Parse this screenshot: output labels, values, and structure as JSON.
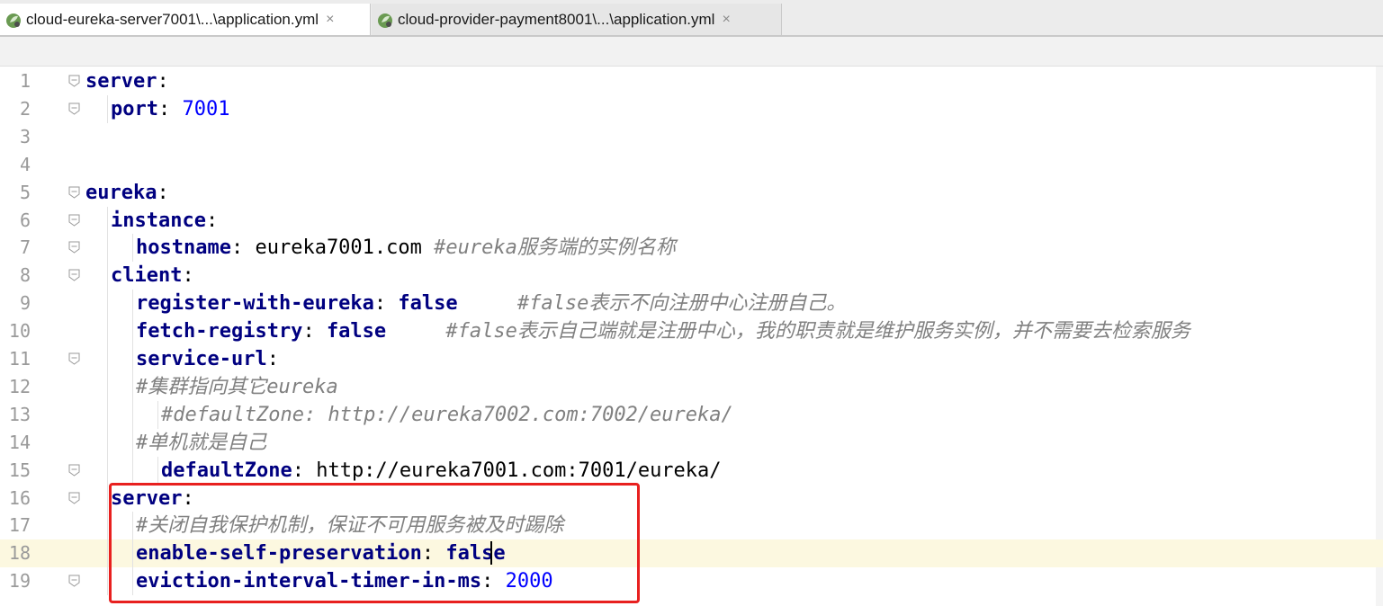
{
  "tabs": [
    {
      "label": "cloud-eureka-server7001\\...\\application.yml",
      "close": "×",
      "icon": "spring-leaf-icon",
      "active": true
    },
    {
      "label": "cloud-provider-payment8001\\...\\application.yml",
      "close": "×",
      "icon": "spring-leaf-icon",
      "active": false
    }
  ],
  "colors": {
    "highlight_box": "#e8201f",
    "keyword": "#000080",
    "number": "#0000ff",
    "comment": "#808080",
    "current_line": "#fcf8e0"
  },
  "lines": [
    {
      "n": "1",
      "indent": 0,
      "parts": [
        {
          "t": "k",
          "v": "server"
        },
        {
          "t": "p",
          "v": ":"
        }
      ]
    },
    {
      "n": "2",
      "indent": 1,
      "parts": [
        {
          "t": "k",
          "v": "port"
        },
        {
          "t": "p",
          "v": ": "
        },
        {
          "t": "n",
          "v": "7001"
        }
      ]
    },
    {
      "n": "3",
      "indent": 0,
      "parts": []
    },
    {
      "n": "4",
      "indent": 0,
      "parts": []
    },
    {
      "n": "5",
      "indent": 0,
      "parts": [
        {
          "t": "k",
          "v": "eureka"
        },
        {
          "t": "p",
          "v": ":"
        }
      ]
    },
    {
      "n": "6",
      "indent": 1,
      "parts": [
        {
          "t": "k",
          "v": "instance"
        },
        {
          "t": "p",
          "v": ":"
        }
      ]
    },
    {
      "n": "7",
      "indent": 2,
      "parts": [
        {
          "t": "k",
          "v": "hostname"
        },
        {
          "t": "p",
          "v": ": "
        },
        {
          "t": "s",
          "v": "eureka7001.com "
        },
        {
          "t": "c",
          "v": "#eureka服务端的实例名称"
        }
      ]
    },
    {
      "n": "8",
      "indent": 1,
      "parts": [
        {
          "t": "k",
          "v": "client"
        },
        {
          "t": "p",
          "v": ":"
        }
      ]
    },
    {
      "n": "9",
      "indent": 2,
      "parts": [
        {
          "t": "k",
          "v": "register-with-eureka"
        },
        {
          "t": "p",
          "v": ": "
        },
        {
          "t": "v",
          "v": "false"
        },
        {
          "t": "p",
          "v": "     "
        },
        {
          "t": "c",
          "v": "#false表示不向注册中心注册自己。"
        }
      ]
    },
    {
      "n": "10",
      "indent": 2,
      "parts": [
        {
          "t": "k",
          "v": "fetch-registry"
        },
        {
          "t": "p",
          "v": ": "
        },
        {
          "t": "v",
          "v": "false"
        },
        {
          "t": "p",
          "v": "     "
        },
        {
          "t": "c",
          "v": "#false表示自己端就是注册中心，我的职责就是维护服务实例，并不需要去检索服务"
        }
      ]
    },
    {
      "n": "11",
      "indent": 2,
      "parts": [
        {
          "t": "k",
          "v": "service-url"
        },
        {
          "t": "p",
          "v": ":"
        }
      ]
    },
    {
      "n": "12",
      "indent": 2,
      "parts": [
        {
          "t": "c",
          "v": "#集群指向其它eureka"
        }
      ]
    },
    {
      "n": "13",
      "indent": 3,
      "parts": [
        {
          "t": "c",
          "v": "#defaultZone: http://eureka7002.com:7002/eureka/"
        }
      ]
    },
    {
      "n": "14",
      "indent": 2,
      "parts": [
        {
          "t": "c",
          "v": "#单机就是自己"
        }
      ]
    },
    {
      "n": "15",
      "indent": 3,
      "parts": [
        {
          "t": "k",
          "v": "defaultZone"
        },
        {
          "t": "p",
          "v": ": "
        },
        {
          "t": "s",
          "v": "http://eureka7001.com:7001/eureka/"
        }
      ]
    },
    {
      "n": "16",
      "indent": 1,
      "parts": [
        {
          "t": "k",
          "v": "server"
        },
        {
          "t": "p",
          "v": ":"
        }
      ]
    },
    {
      "n": "17",
      "indent": 2,
      "parts": [
        {
          "t": "c",
          "v": "#关闭自我保护机制，保证不可用服务被及时踢除"
        }
      ]
    },
    {
      "n": "18",
      "indent": 2,
      "parts": [
        {
          "t": "k",
          "v": "enable-self-preservation"
        },
        {
          "t": "p",
          "v": ": "
        },
        {
          "t": "v",
          "v": "false"
        }
      ]
    },
    {
      "n": "19",
      "indent": 2,
      "parts": [
        {
          "t": "k",
          "v": "eviction-interval-timer-in-ms"
        },
        {
          "t": "p",
          "v": ": "
        },
        {
          "t": "n",
          "v": "2000"
        }
      ]
    }
  ],
  "folds": [
    "1",
    "2",
    "5",
    "6",
    "7",
    "8",
    "11",
    "15",
    "16",
    "19"
  ],
  "current_line": "18"
}
